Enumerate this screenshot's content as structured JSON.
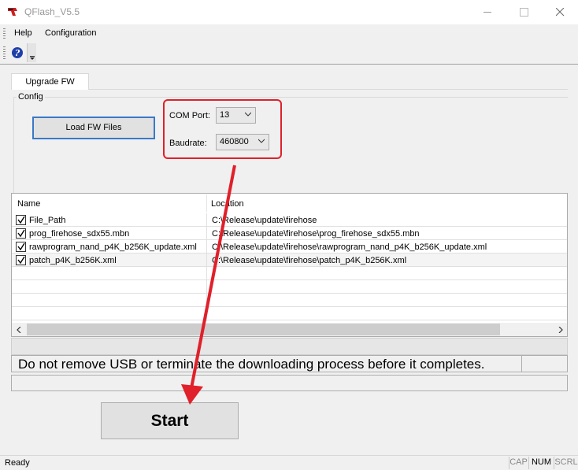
{
  "window": {
    "title": "QFlash_V5.5",
    "minimize_icon": "minimize-icon",
    "maximize_icon": "maximize-icon",
    "close_icon": "close-icon"
  },
  "menu": {
    "items": [
      "Help",
      "Configuration"
    ]
  },
  "toolbar": {
    "help_icon": "help-question-icon"
  },
  "tabs": [
    {
      "label": "Upgrade FW",
      "selected": true
    }
  ],
  "config": {
    "group_label": "Config",
    "load_button": "Load FW Files",
    "com_port": {
      "label": "COM Port:",
      "value": "13"
    },
    "baudrate": {
      "label": "Baudrate:",
      "value": "460800"
    }
  },
  "file_list": {
    "columns": [
      "Name",
      "Location"
    ],
    "rows": [
      {
        "checked": true,
        "name": "File_Path",
        "location": "C:\\Release\\update\\firehose"
      },
      {
        "checked": true,
        "name": "prog_firehose_sdx55.mbn",
        "location": "C:\\Release\\update\\firehose\\prog_firehose_sdx55.mbn"
      },
      {
        "checked": true,
        "name": "rawprogram_nand_p4K_b256K_update.xml",
        "location": "C:\\Release\\update\\firehose\\rawprogram_nand_p4K_b256K_update.xml"
      },
      {
        "checked": true,
        "name": "patch_p4K_b256K.xml",
        "location": "C:\\Release\\update\\firehose\\patch_p4K_b256K.xml"
      }
    ]
  },
  "warning_text": "Do not remove USB or terminate the downloading process before it completes.",
  "start_button": "Start",
  "status": {
    "text": "Ready",
    "indicators": [
      "CAP",
      "NUM",
      "SCRL"
    ],
    "active_indicator": "NUM"
  },
  "colors": {
    "highlight": "#e0202a",
    "focus_border": "#3a78c8"
  }
}
